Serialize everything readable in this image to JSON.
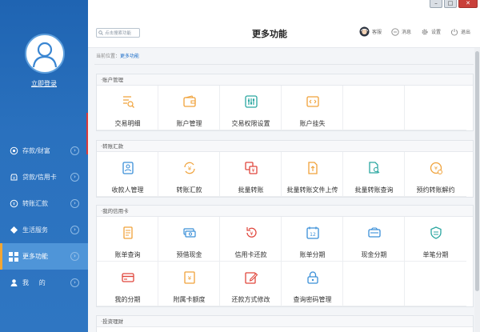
{
  "window": {
    "controls": [
      "–",
      "□",
      "✕"
    ]
  },
  "sidebar": {
    "login_label": "立即登录",
    "items": [
      {
        "label": "存款/财富",
        "icon": "coin-icon"
      },
      {
        "label": "贷款/信用卡",
        "icon": "loan-icon"
      },
      {
        "label": "转账汇款",
        "icon": "transfer-icon"
      },
      {
        "label": "生活服务",
        "icon": "service-icon"
      },
      {
        "label": "更多功能",
        "icon": "grid-icon",
        "active": true
      },
      {
        "label": "我     的",
        "icon": "user-icon"
      }
    ],
    "arrow": "›"
  },
  "header": {
    "search_placeholder": "点击搜索功能",
    "title": "更多功能",
    "tools": [
      {
        "label": "客服",
        "icon": "headset-icon"
      },
      {
        "label": "消息",
        "icon": "message-icon"
      },
      {
        "label": "设置",
        "icon": "gear-icon"
      },
      {
        "label": "退出",
        "icon": "power-icon"
      }
    ]
  },
  "breadcrumb": {
    "prefix": "当前位置：",
    "current": "更多功能"
  },
  "sections": [
    {
      "title": "·账户管理",
      "items": [
        "交易明细",
        "账户管理",
        "交易权限设置",
        "账户挂失"
      ]
    },
    {
      "title": "·转账汇款",
      "items": [
        "收款人管理",
        "转账汇款",
        "批量转账",
        "批量转账文件上传",
        "批量转账查询",
        "预约转账解约"
      ]
    },
    {
      "title": "·我的信用卡",
      "items": [
        "账单查询",
        "预借现金",
        "信用卡还款",
        "账单分期",
        "现金分期",
        "单笔分期",
        "我的分期",
        "附属卡额度",
        "还款方式修改",
        "查询密码管理"
      ]
    },
    {
      "title": "·投资理财",
      "items": []
    }
  ],
  "colors": {
    "sidebar": "#2a71be",
    "active_item": "#4f95d8",
    "accent_orange": "#f3a633",
    "icon_orange": "#f0a23a",
    "icon_teal": "#2aa6a0",
    "icon_red": "#e0463c",
    "icon_blue": "#3a8fd8"
  }
}
